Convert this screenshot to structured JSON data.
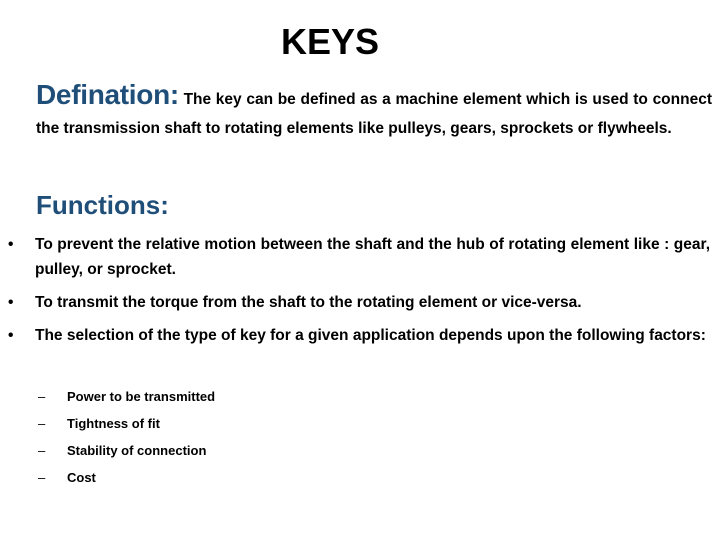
{
  "title": "KEYS",
  "definition": {
    "label": "Defination:",
    "text": " The key can be defined as a machine element which is used to connect the transmission shaft to rotating elements like pulleys, gears, sprockets or flywheels."
  },
  "functions": {
    "heading": "Functions:",
    "bullet_glyph": "•",
    "items": [
      {
        "text": "To prevent the relative motion between the shaft and the hub of rotating element like : gear, pulley, or sprocket."
      },
      {
        "text": "To transmit the torque from the shaft to the rotating element or vice-versa."
      },
      {
        "text": "The selection of the type of key for a given application depends upon the following factors:"
      }
    ],
    "sub_glyph": "–",
    "factors": [
      {
        "text": "Power to be transmitted"
      },
      {
        "text": "Tightness of fit"
      },
      {
        "text": "Stability of connection"
      },
      {
        "text": "Cost"
      }
    ]
  },
  "colors": {
    "heading_accent": "#1f4e79",
    "body_text": "#000000",
    "background": "#ffffff"
  }
}
